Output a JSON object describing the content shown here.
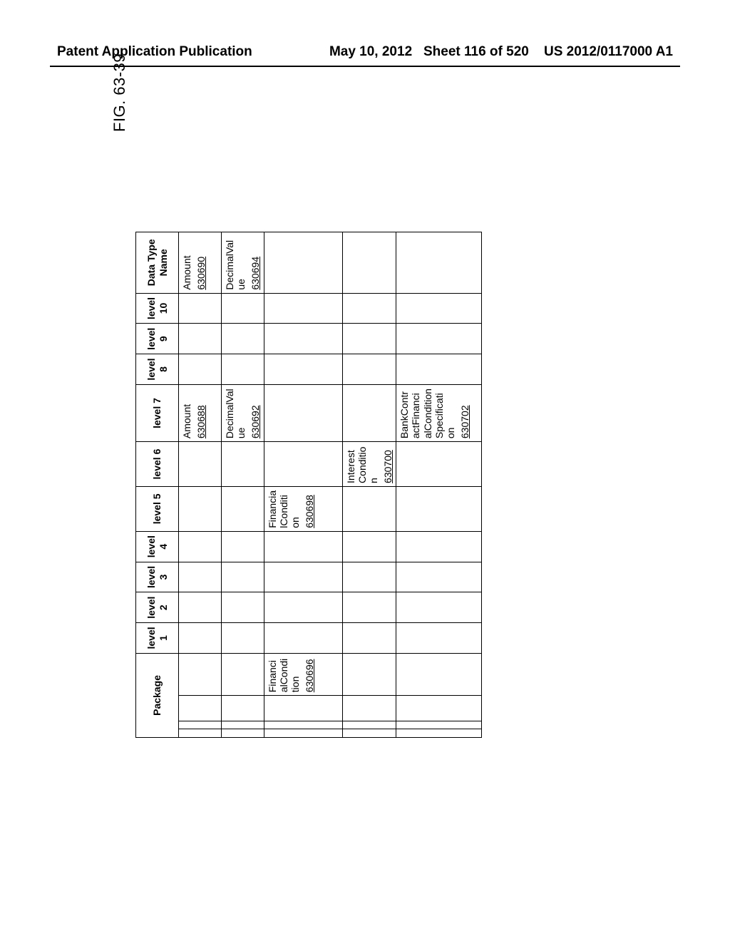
{
  "header": {
    "left": "Patent Application Publication",
    "date": "May 10, 2012",
    "sheet": "Sheet 116 of 520",
    "pubno": "US 2012/0117000 A1"
  },
  "figure_label": "FIG. 63-39",
  "columns": {
    "package": "Package",
    "l1": "level 1",
    "l2": "level 2",
    "l3": "level 3",
    "l4": "level 4",
    "l5": "level 5",
    "l6": "level 6",
    "l7": "level 7",
    "l8": "level 8",
    "l9": "level 9",
    "l10": "level 10",
    "dtn": "Data Type Name"
  },
  "rows": [
    {
      "package": "",
      "l7": {
        "text": "Amount",
        "ref": "630688"
      },
      "dtn": {
        "text": "Amount",
        "ref": "630690"
      }
    },
    {
      "package": "",
      "l7": {
        "text": "DecimalValue",
        "ref": "630692"
      },
      "dtn": {
        "text": "DecimalValue",
        "ref": "630694"
      }
    },
    {
      "package": {
        "text": "FinancialCondition",
        "ref": "630696"
      },
      "l5": {
        "text": "FinancialCondition",
        "ref": "630698"
      }
    },
    {
      "l6": {
        "text": "InterestCondition",
        "ref": "630700"
      }
    },
    {
      "l7": {
        "text": "BankContractFinancialConditionSpecification",
        "ref": "630702"
      }
    }
  ]
}
